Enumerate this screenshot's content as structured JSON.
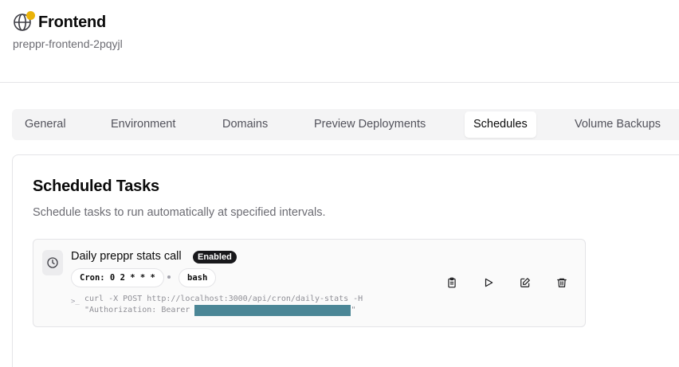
{
  "header": {
    "icon": "globe-icon",
    "status_dot_color": "#eab308",
    "title": "Frontend",
    "subtitle": "preppr-frontend-2pqyjl"
  },
  "tabs": [
    {
      "label": "General",
      "active": false
    },
    {
      "label": "Environment",
      "active": false
    },
    {
      "label": "Domains",
      "active": false
    },
    {
      "label": "Preview Deployments",
      "active": false
    },
    {
      "label": "Schedules",
      "active": true
    },
    {
      "label": "Volume Backups",
      "active": false
    }
  ],
  "panel": {
    "title": "Scheduled Tasks",
    "description": "Schedule tasks to run automatically at specified intervals."
  },
  "task": {
    "icon": "clock-icon",
    "name": "Daily preppr stats call",
    "status": "Enabled",
    "cron_label": "Cron: 0 2 * * *",
    "shell": "bash",
    "command_line1": "curl -X POST http://localhost:3000/api/cron/daily-stats -H",
    "command_line2_prefix": "\"Authorization: Bearer ",
    "command_line2_suffix": "\"",
    "redaction_color": "#4b8696",
    "actions": [
      "clipboard-icon",
      "play-icon",
      "edit-icon",
      "trash-icon"
    ]
  }
}
